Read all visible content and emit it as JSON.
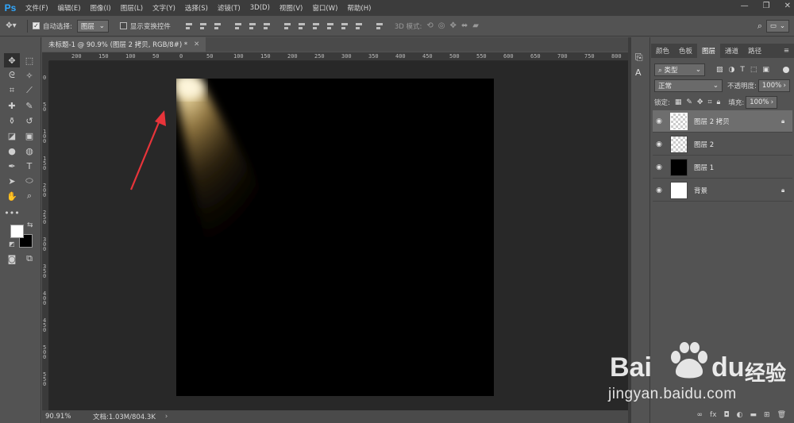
{
  "app": {
    "logo": "Ps"
  },
  "menu": [
    "文件(F)",
    "编辑(E)",
    "图像(I)",
    "图层(L)",
    "文字(Y)",
    "选择(S)",
    "滤镜(T)",
    "3D(D)",
    "视图(V)",
    "窗口(W)",
    "帮助(H)"
  ],
  "options": {
    "auto_select_label": "自动选择:",
    "auto_select_value": "图层",
    "show_transform_label": "显示变换控件",
    "mode_3d_label": "3D 模式:"
  },
  "document": {
    "tab_title": "未标题-1 @ 90.9% (图层 2 拷贝, RGB/8#) *",
    "zoom": "90.91%",
    "doc_info": "文档:1.03M/804.3K"
  },
  "ruler": {
    "top_labels": [
      "200",
      "150",
      "100",
      "50",
      "0",
      "50",
      "100",
      "150",
      "200",
      "250",
      "300",
      "350",
      "400",
      "450",
      "500",
      "550",
      "600",
      "650",
      "700",
      "750",
      "800"
    ],
    "left_labels": [
      "0",
      "5 0",
      "1 0 0",
      "1 5 0",
      "2 0 0",
      "2 5 0",
      "3 0 0",
      "3 5 0",
      "4 0 0",
      "4 5 0",
      "5 0 0",
      "5 5 0"
    ]
  },
  "layers_panel": {
    "tabs": [
      "颜色",
      "色板",
      "图层",
      "通道",
      "路径"
    ],
    "active_tab": "图层",
    "filter_kind": "类型",
    "blend_mode": "正常",
    "opacity_label": "不透明度:",
    "opacity_value": "100%",
    "lock_label": "锁定:",
    "fill_label": "填充:",
    "fill_value": "100%",
    "layers": [
      {
        "name": "图层 2 拷贝",
        "selected": true,
        "locked": true
      },
      {
        "name": "图层 2",
        "selected": false,
        "locked": false
      },
      {
        "name": "图层 1",
        "selected": false,
        "locked": false
      },
      {
        "name": "背景",
        "selected": false,
        "locked": true
      }
    ]
  },
  "watermark": {
    "brand": "Bai",
    "brand2": "du",
    "brand_cn": "经验",
    "url": "jingyan.baidu.com"
  },
  "colors": {
    "accent": "#31a8ff",
    "spotlight": "#f2d79a",
    "arrow": "#e8343a"
  }
}
